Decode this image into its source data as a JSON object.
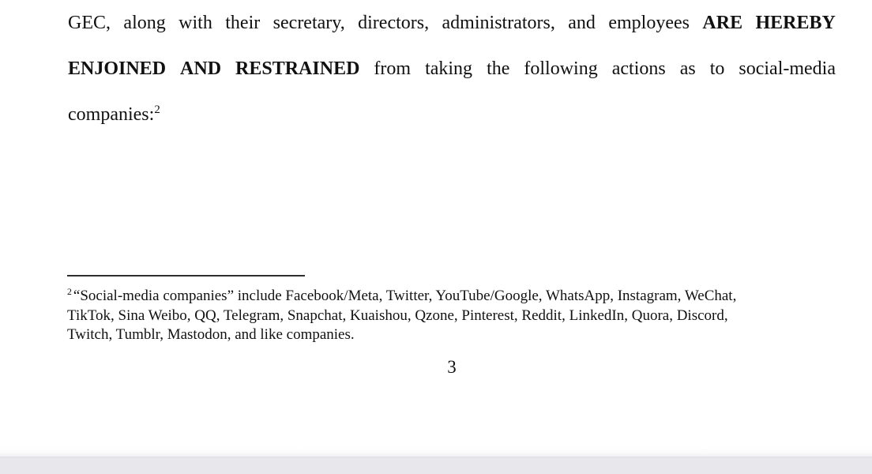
{
  "document": {
    "page_number": "3",
    "body": {
      "line1": {
        "text_before_bold": "GEC, along with their secretary, directors, administrators, and employees",
        "bold_text": "ARE HEREBY",
        "words": [
          "GEC,",
          "along",
          "with",
          "their",
          "secretary,",
          "directors,",
          "administrators,",
          "and",
          "employees"
        ],
        "bold_words": [
          "ARE",
          "HEREBY"
        ]
      },
      "line2": {
        "bold_text": "ENJOINED AND RESTRAINED",
        "bold_words": [
          "ENJOINED",
          "AND",
          "RESTRAINED"
        ],
        "text_after_bold": "from taking the following actions as to social-media",
        "words": [
          "from",
          "taking",
          "the",
          "following",
          "actions",
          "as",
          "to",
          "social-media"
        ]
      },
      "line3": {
        "text": "companies:",
        "footnote_ref": "2"
      }
    },
    "footnote": {
      "number": "2",
      "line1": "“Social-media companies” include Facebook/Meta, Twitter, YouTube/Google, WhatsApp, Instagram, WeChat,",
      "line2": "TikTok, Sina Weibo, QQ, Telegram, Snapchat, Kuaishou, Qzone, Pinterest, Reddit, LinkedIn, Quora, Discord,",
      "line3": "Twitch, Tumblr, Mastodon, and like companies.",
      "full_text": "“Social-media companies” include Facebook/Meta, Twitter, YouTube/Google, WhatsApp, Instagram, WeChat, TikTok, Sina Weibo, QQ, Telegram, Snapchat, Kuaishou, Qzone, Pinterest, Reddit, LinkedIn, Quora, Discord, Twitch, Tumblr, Mastodon, and like companies."
    },
    "colors": {
      "page_background": "#ffffff",
      "viewer_background": "#e7e7ec",
      "text": "#111111",
      "footnote_rule": "#2e2e2e"
    }
  }
}
